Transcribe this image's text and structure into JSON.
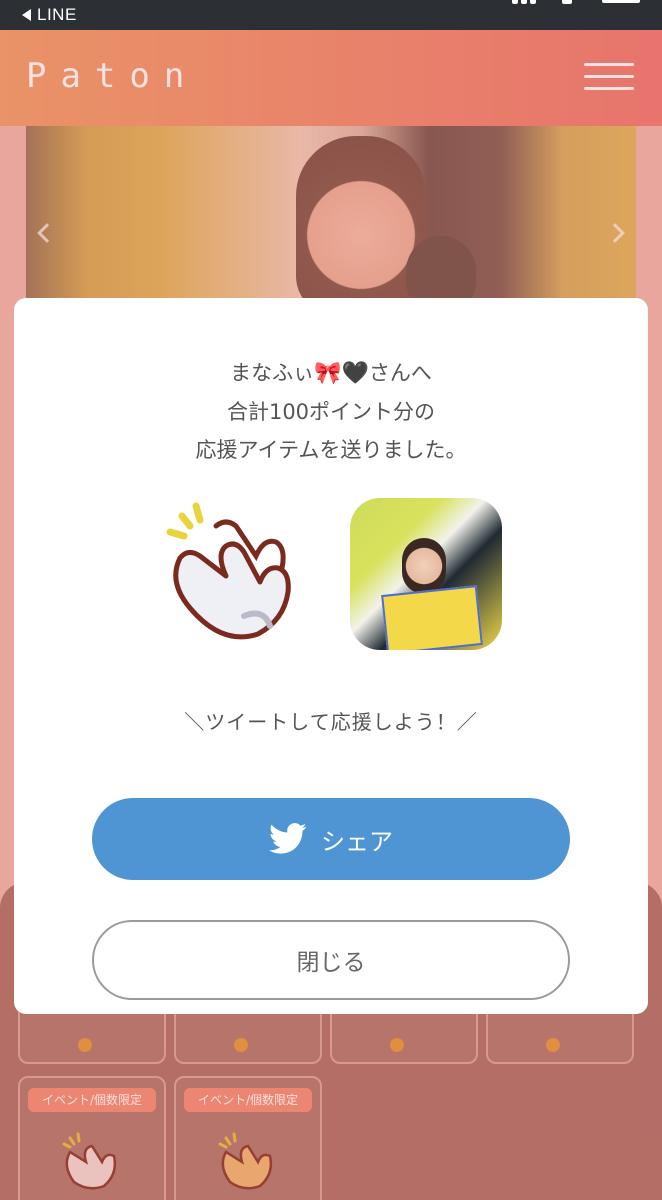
{
  "statusbar": {
    "back_label": "LINE"
  },
  "header": {
    "logo": "Paton"
  },
  "modal": {
    "line1_name": "まなふぃ",
    "line1_emoji": "🎀🖤",
    "line1_suffix": "さんへ",
    "line2": "合計100ポイント分の",
    "line3": "応援アイテムを送りました。",
    "cta": "＼ツイートして応援しよう！／",
    "share_label": "シェア",
    "close_label": "閉じる"
  },
  "grid": {
    "tag_label": "イベント/個数限定"
  },
  "colors": {
    "header_start": "#f1a06b",
    "header_end": "#ed7b72",
    "share_button": "#4f95d3",
    "tag": "#f39078"
  }
}
